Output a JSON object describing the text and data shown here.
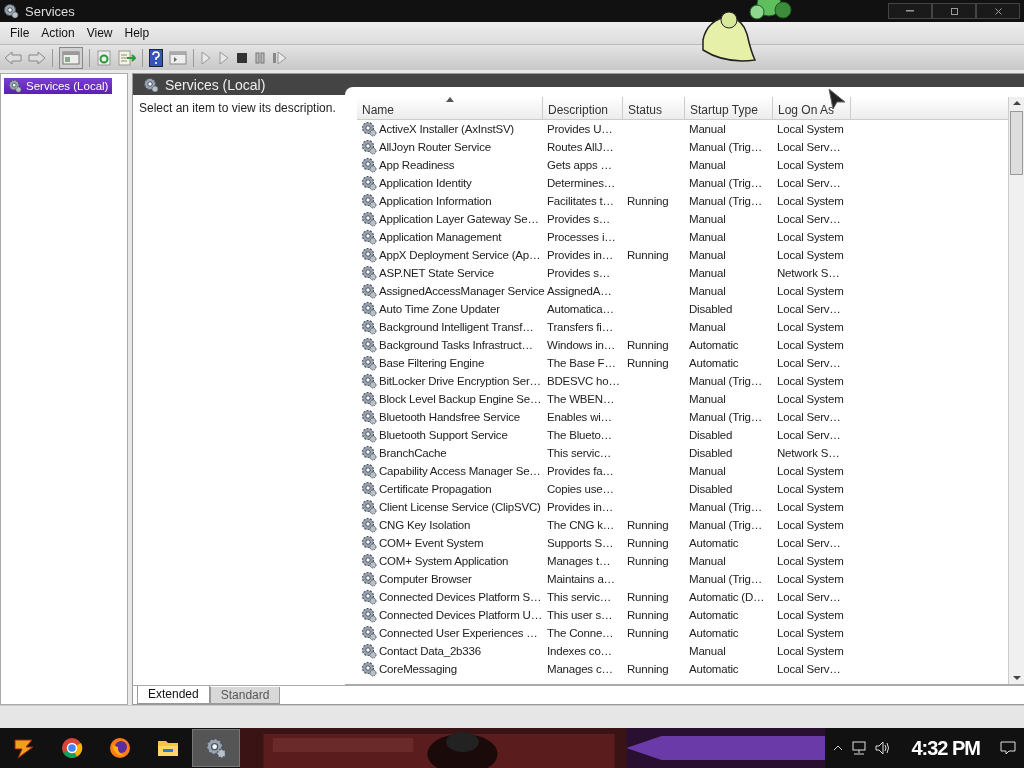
{
  "window": {
    "title": "Services"
  },
  "menu": [
    "File",
    "Action",
    "View",
    "Help"
  ],
  "tree": {
    "items": [
      {
        "label": "Services (Local)",
        "selected": true
      }
    ]
  },
  "pane": {
    "title": "Services (Local)",
    "description": "Select an item to view its description."
  },
  "table": {
    "columns": [
      {
        "label": "Name",
        "sorted": true
      },
      {
        "label": "Description",
        "sorted": false
      },
      {
        "label": "Status",
        "sorted": false
      },
      {
        "label": "Startup Type",
        "sorted": false
      },
      {
        "label": "Log On As",
        "sorted": false
      }
    ],
    "rows": [
      {
        "name": "ActiveX Installer (AxInstSV)",
        "description": "Provides U…",
        "startup": "Manual",
        "logon": "Local System"
      },
      {
        "name": "AllJoyn Router Service",
        "description": "Routes AllJ…",
        "startup": "Manual (Trig…",
        "logon": "Local Serv…"
      },
      {
        "name": "App Readiness",
        "description": "Gets apps …",
        "startup": "Manual",
        "logon": "Local System"
      },
      {
        "name": "Application Identity",
        "description": "Determines…",
        "startup": "Manual (Trig…",
        "logon": "Local Serv…"
      },
      {
        "name": "Application Information",
        "description": "Facilitates t…",
        "status": "Running",
        "startup": "Manual (Trig…",
        "logon": "Local System"
      },
      {
        "name": "Application Layer Gateway Se…",
        "description": "Provides s…",
        "startup": "Manual",
        "logon": "Local Serv…"
      },
      {
        "name": "Application Management",
        "description": "Processes i…",
        "startup": "Manual",
        "logon": "Local System"
      },
      {
        "name": "AppX Deployment Service (Ap…",
        "description": "Provides in…",
        "status": "Running",
        "startup": "Manual",
        "logon": "Local System"
      },
      {
        "name": "ASP.NET State Service",
        "description": "Provides s…",
        "startup": "Manual",
        "logon": "Network S…"
      },
      {
        "name": "AssignedAccessManager Service",
        "description": "AssignedA…",
        "startup": "Manual",
        "logon": "Local System"
      },
      {
        "name": "Auto Time Zone Updater",
        "description": "Automatica…",
        "startup": "Disabled",
        "logon": "Local Serv…"
      },
      {
        "name": "Background Intelligent Transf…",
        "description": "Transfers fi…",
        "startup": "Manual",
        "logon": "Local System"
      },
      {
        "name": "Background Tasks Infrastruct…",
        "description": "Windows in…",
        "status": "Running",
        "startup": "Automatic",
        "logon": "Local System"
      },
      {
        "name": "Base Filtering Engine",
        "description": "The Base F…",
        "status": "Running",
        "startup": "Automatic",
        "logon": "Local Serv…"
      },
      {
        "name": "BitLocker Drive Encryption Ser…",
        "description": "BDESVC ho…",
        "startup": "Manual (Trig…",
        "logon": "Local System"
      },
      {
        "name": "Block Level Backup Engine Se…",
        "description": "The WBEN…",
        "startup": "Manual",
        "logon": "Local System"
      },
      {
        "name": "Bluetooth Handsfree Service",
        "description": "Enables wi…",
        "startup": "Manual (Trig…",
        "logon": "Local Serv…"
      },
      {
        "name": "Bluetooth Support Service",
        "description": "The Blueto…",
        "startup": "Disabled",
        "logon": "Local Serv…"
      },
      {
        "name": "BranchCache",
        "description": "This servic…",
        "startup": "Disabled",
        "logon": "Network S…"
      },
      {
        "name": "Capability Access Manager Se…",
        "description": "Provides fa…",
        "startup": "Manual",
        "logon": "Local System"
      },
      {
        "name": "Certificate Propagation",
        "description": "Copies use…",
        "startup": "Disabled",
        "logon": "Local System"
      },
      {
        "name": "Client License Service (ClipSVC)",
        "description": "Provides in…",
        "startup": "Manual (Trig…",
        "logon": "Local System"
      },
      {
        "name": "CNG Key Isolation",
        "description": "The CNG k…",
        "status": "Running",
        "startup": "Manual (Trig…",
        "logon": "Local System"
      },
      {
        "name": "COM+ Event System",
        "description": "Supports S…",
        "status": "Running",
        "startup": "Automatic",
        "logon": "Local Serv…"
      },
      {
        "name": "COM+ System Application",
        "description": "Manages t…",
        "status": "Running",
        "startup": "Manual",
        "logon": "Local System"
      },
      {
        "name": "Computer Browser",
        "description": "Maintains a…",
        "startup": "Manual (Trig…",
        "logon": "Local System"
      },
      {
        "name": "Connected Devices Platform S…",
        "description": "This servic…",
        "status": "Running",
        "startup": "Automatic (D…",
        "logon": "Local Serv…"
      },
      {
        "name": "Connected Devices Platform U…",
        "description": "This user s…",
        "status": "Running",
        "startup": "Automatic",
        "logon": "Local System"
      },
      {
        "name": "Connected User Experiences …",
        "description": "The Conne…",
        "status": "Running",
        "startup": "Automatic",
        "logon": "Local System"
      },
      {
        "name": "Contact Data_2b336",
        "description": "Indexes co…",
        "startup": "Manual",
        "logon": "Local System"
      },
      {
        "name": "CoreMessaging",
        "description": "Manages c…",
        "status": "Running",
        "startup": "Automatic",
        "logon": "Local Serv…"
      }
    ]
  },
  "tabs": [
    {
      "label": "Extended",
      "selected": true
    },
    {
      "label": "Standard",
      "selected": false
    }
  ],
  "taskbar": {
    "apps": [
      {
        "kind": "start",
        "active": false
      },
      {
        "kind": "chrome",
        "active": false
      },
      {
        "kind": "firefox",
        "active": false
      },
      {
        "kind": "files",
        "active": false
      },
      {
        "kind": "services",
        "active": true
      }
    ],
    "clock": "4:32 PM"
  }
}
